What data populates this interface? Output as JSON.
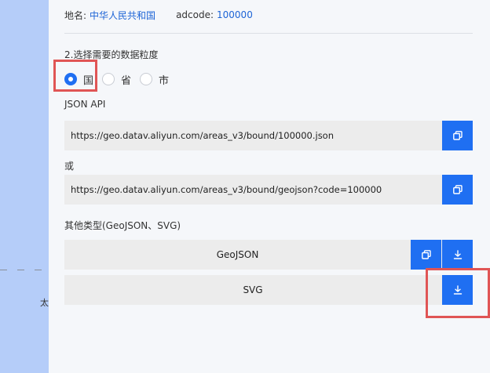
{
  "map": {
    "label": "太"
  },
  "info": {
    "name_label": "地名:",
    "name_value": "中华人民共和国",
    "adcode_label": "adcode:",
    "adcode_value": "100000"
  },
  "granularity": {
    "title": "2.选择需要的数据粒度",
    "options": [
      {
        "label": "国",
        "checked": true
      },
      {
        "label": "省",
        "checked": false
      },
      {
        "label": "市",
        "checked": false
      }
    ]
  },
  "json_api": {
    "title": "JSON API",
    "url1": "https://geo.datav.aliyun.com/areas_v3/bound/100000.json",
    "or_label": "或",
    "url2": "https://geo.datav.aliyun.com/areas_v3/bound/geojson?code=100000"
  },
  "other_types": {
    "title": "其他类型(GeoJSON、SVG)",
    "geojson_label": "GeoJSON",
    "svg_label": "SVG"
  },
  "icons": {
    "copy": "copy-icon",
    "download": "download-icon"
  },
  "colors": {
    "accent": "#1f6ff2",
    "link": "#1d64d6",
    "highlight": "#e05555",
    "map_bg": "#b5cdf9"
  }
}
